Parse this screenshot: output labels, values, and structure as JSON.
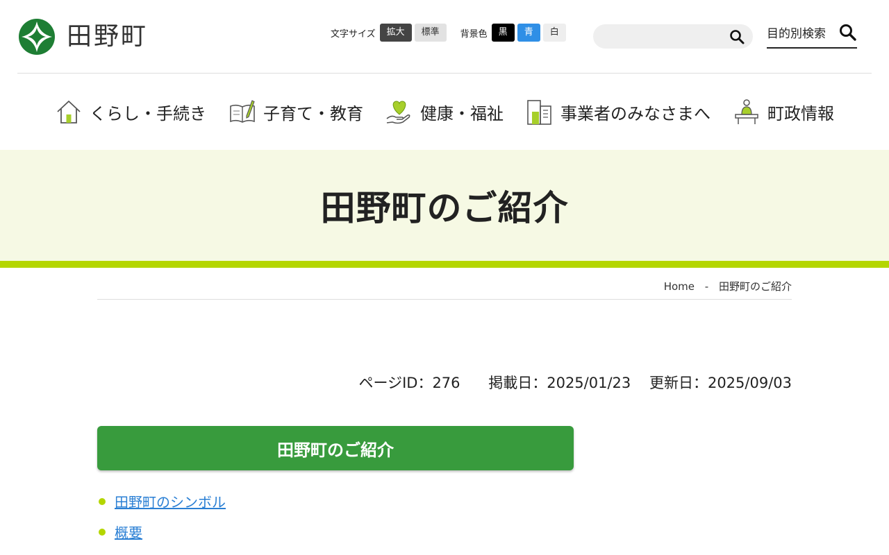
{
  "site": {
    "name": "田野町"
  },
  "tools": {
    "font_size_label": "文字サイズ",
    "font_large": "拡大",
    "font_standard": "標準",
    "bg_color_label": "背景色",
    "bg_black": "黒",
    "bg_blue": "青",
    "bg_white": "白"
  },
  "search": {
    "placeholder": ""
  },
  "purpose_search": {
    "label": "目的別検索"
  },
  "gnav": {
    "items": [
      {
        "label": "くらし・手続き",
        "icon": "house-icon"
      },
      {
        "label": "子育て・教育",
        "icon": "book-pencil-icon"
      },
      {
        "label": "健康・福祉",
        "icon": "heart-hand-icon"
      },
      {
        "label": "事業者のみなさまへ",
        "icon": "buildings-icon"
      },
      {
        "label": "町政情報",
        "icon": "podium-speaker-icon"
      }
    ]
  },
  "page": {
    "title": "田野町のご紹介"
  },
  "breadcrumb": {
    "home": "Home",
    "separator": "-",
    "current": "田野町のご紹介"
  },
  "meta": {
    "page_id": "ページID：276",
    "posted": "掲載日：2025/01/23",
    "updated": "更新日：2025/09/03"
  },
  "section": {
    "heading": "田野町のご紹介",
    "links": [
      "田野町のシンボル",
      "概要"
    ]
  },
  "colors": {
    "brand_green": "#1e7e34",
    "section_green": "#389b3d",
    "lime_accent": "#b4d600",
    "title_band_bg": "#f6f9e4",
    "link_blue": "#2a7fd4"
  }
}
